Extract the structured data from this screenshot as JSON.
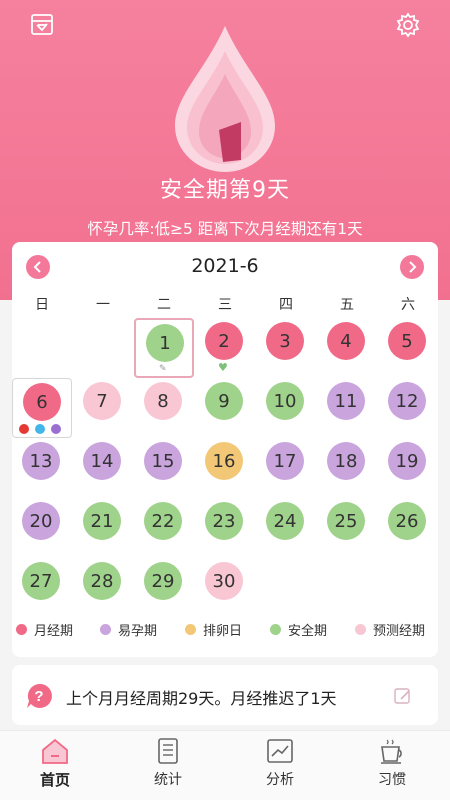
{
  "header": {
    "left_icon": "calendar-icon",
    "right_icon": "gear-icon",
    "status_title": "安全期第9天",
    "status_sub": "怀孕几率:低≥5 距离下次月经期还有1天"
  },
  "calendar": {
    "month_label": "2021-6",
    "prev_icon": "chevron-left-icon",
    "next_icon": "chevron-right-icon",
    "weekdays": [
      "日",
      "一",
      "二",
      "三",
      "四",
      "五",
      "六"
    ],
    "days": [
      {
        "label": "1",
        "type": "safe",
        "today": true
      },
      {
        "label": "2",
        "type": "period",
        "heart": true
      },
      {
        "label": "3",
        "type": "period"
      },
      {
        "label": "4",
        "type": "period"
      },
      {
        "label": "5",
        "type": "period"
      },
      {
        "label": "6",
        "type": "period",
        "outlined": true,
        "markers": true
      },
      {
        "label": "7",
        "type": "pred"
      },
      {
        "label": "8",
        "type": "pred"
      },
      {
        "label": "9",
        "type": "safe"
      },
      {
        "label": "10",
        "type": "safe"
      },
      {
        "label": "11",
        "type": "fertile"
      },
      {
        "label": "12",
        "type": "fertile"
      },
      {
        "label": "13",
        "type": "fertile"
      },
      {
        "label": "14",
        "type": "fertile"
      },
      {
        "label": "15",
        "type": "fertile"
      },
      {
        "label": "16",
        "type": "ovu"
      },
      {
        "label": "17",
        "type": "fertile"
      },
      {
        "label": "18",
        "type": "fertile"
      },
      {
        "label": "19",
        "type": "fertile"
      },
      {
        "label": "20",
        "type": "fertile"
      },
      {
        "label": "21",
        "type": "safe"
      },
      {
        "label": "22",
        "type": "safe"
      },
      {
        "label": "23",
        "type": "safe"
      },
      {
        "label": "24",
        "type": "safe"
      },
      {
        "label": "25",
        "type": "safe"
      },
      {
        "label": "26",
        "type": "safe"
      },
      {
        "label": "27",
        "type": "safe"
      },
      {
        "label": "28",
        "type": "safe"
      },
      {
        "label": "29",
        "type": "safe"
      },
      {
        "label": "30",
        "type": "pred"
      }
    ],
    "legend": [
      {
        "label": "月经期",
        "color": "#f06a87"
      },
      {
        "label": "易孕期",
        "color": "#c9a4dd"
      },
      {
        "label": "排卵日",
        "color": "#f2c877"
      },
      {
        "label": "安全期",
        "color": "#9fd28a"
      },
      {
        "label": "预测经期",
        "color": "#f9c6d4"
      }
    ]
  },
  "info": {
    "icon": "question-bubble-icon",
    "text": "上个月月经周期29天。月经推迟了1天",
    "edit_icon": "edit-icon"
  },
  "tabs": [
    {
      "label": "首页",
      "icon": "home-icon",
      "active": true
    },
    {
      "label": "统计",
      "icon": "clipboard-icon",
      "active": false
    },
    {
      "label": "分析",
      "icon": "chart-icon",
      "active": false
    },
    {
      "label": "习惯",
      "icon": "cup-icon",
      "active": false
    }
  ],
  "colors": {
    "accent": "#f3789a",
    "period": "#f06a87",
    "fertile": "#c9a4dd",
    "ovulation": "#f2c877",
    "safe": "#9fd28a",
    "predicted": "#f9c6d4"
  }
}
